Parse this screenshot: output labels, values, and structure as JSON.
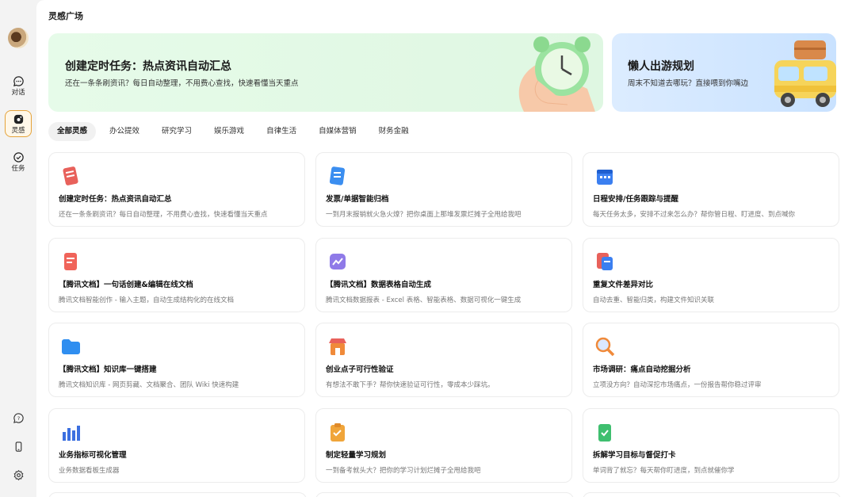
{
  "sidebar": {
    "items": [
      {
        "label": "对话",
        "icon": "chat-icon"
      },
      {
        "label": "灵感",
        "icon": "inspiration-icon",
        "active": true
      },
      {
        "label": "任务",
        "icon": "task-check-icon"
      }
    ],
    "bottom_icons": [
      "help-icon",
      "phone-icon",
      "settings-icon"
    ]
  },
  "page_title": "灵感广场",
  "banners": [
    {
      "title": "创建定时任务：热点资讯自动汇总",
      "desc": "还在一条条刷资讯？每日自动整理，不用费心查找，快速看懂当天重点",
      "icon": "alarm-clock-icon"
    },
    {
      "title": "懒人出游规划",
      "desc": "周末不知道去哪玩？直接喂到你嘴边",
      "icon": "travel-van-icon"
    }
  ],
  "tabs": [
    "全部灵感",
    "办公提效",
    "研究学习",
    "娱乐游戏",
    "自律生活",
    "自媒体营销",
    "财务金融"
  ],
  "active_tab": "全部灵感",
  "cards": [
    {
      "title": "创建定时任务：热点资讯自动汇总",
      "desc": "还在一条条刷资讯？每日自动整理，不用费心查找，快速看懂当天重点",
      "icon": "news-icon",
      "color": "#e8615b"
    },
    {
      "title": "发票/单据智能归档",
      "desc": "一到月末报销就火急火燎？把你桌面上那堆发票烂摊子全甩给我吧",
      "icon": "invoice-icon",
      "color": "#3b8ef0"
    },
    {
      "title": "日程安排/任务跟踪与提醒",
      "desc": "每天任务太多，安排不过来怎么办？帮你管日程、盯进度、到点喊你",
      "icon": "calendar-icon",
      "color": "#3b7ff0"
    },
    {
      "title": "【腾讯文档】一句话创建&编辑在线文档",
      "desc": "腾讯文档智能创作 - 输入主题，自动生成结构化的在线文档",
      "icon": "doc-icon",
      "color": "#f0645a"
    },
    {
      "title": "【腾讯文档】数据表格自动生成",
      "desc": "腾讯文档数据报表 - Excel 表格、智能表格、数据可视化一键生成",
      "icon": "chart-icon",
      "color": "#8f7ae8"
    },
    {
      "title": "重复文件差异对比",
      "desc": "自动去重、智能归类，构建文件知识关联",
      "icon": "compare-icon",
      "color": "#e8615b"
    },
    {
      "title": "【腾讯文档】知识库一键搭建",
      "desc": "腾讯文档知识库 - 网页剪藏、文档聚合、团队 Wiki 快速构建",
      "icon": "folder-icon",
      "color": "#2f8ef0"
    },
    {
      "title": "创业点子可行性验证",
      "desc": "有想法不敢下手？帮你快速验证可行性，零成本少踩坑。",
      "icon": "shop-icon",
      "color": "#f08a3a"
    },
    {
      "title": "市场调研：痛点自动挖掘分析",
      "desc": "立项没方向？自动深挖市场痛点，一份报告帮你稳过评审",
      "icon": "magnifier-icon",
      "color": "#f08a3a"
    },
    {
      "title": "业务指标可视化管理",
      "desc": "业务数据看板生成器",
      "icon": "bar-chart-icon",
      "color": "#3b6fe0"
    },
    {
      "title": "制定轻量学习规划",
      "desc": "一到备考就头大？把你的学习计划烂摊子全甩给我吧",
      "icon": "clipboard-icon",
      "color": "#f0a53a"
    },
    {
      "title": "拆解学习目标与督促打卡",
      "desc": "单词背了就忘？每天帮你盯进度，到点就催你学",
      "icon": "checkin-icon",
      "color": "#3fbf6f"
    }
  ]
}
